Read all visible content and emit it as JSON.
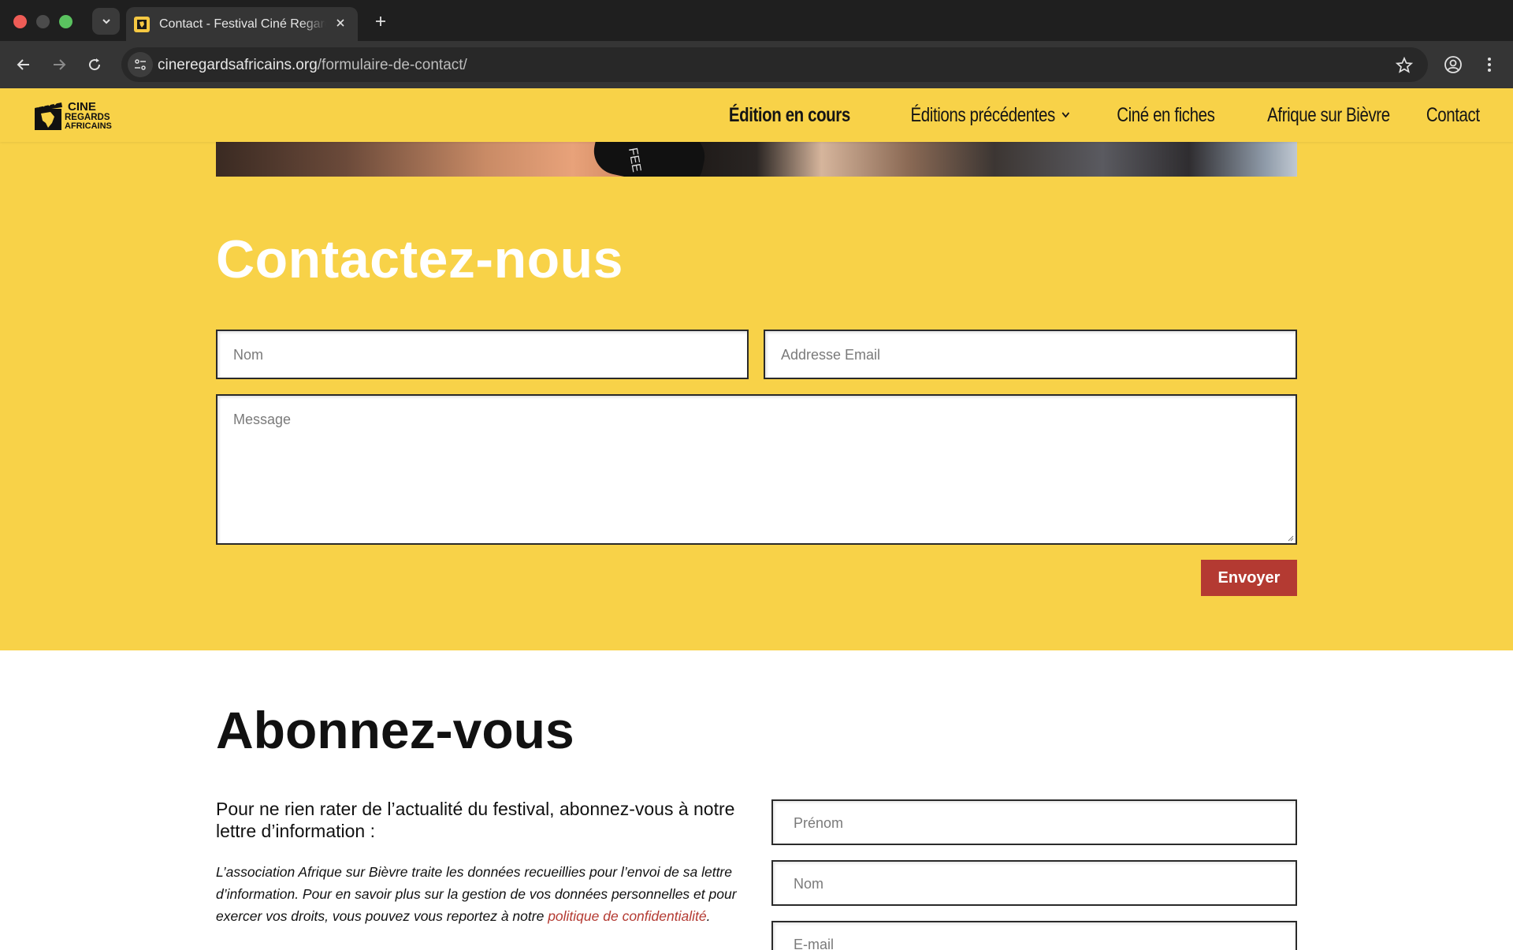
{
  "browser": {
    "tab_title": "Contact - Festival Ciné Regards Africains",
    "url_domain": "cineregardsafricains.org",
    "url_path": "/formulaire-de-contact/"
  },
  "site": {
    "logo_lines": [
      "CINE",
      "REGARDS",
      "AFRICAINS"
    ],
    "menu": [
      {
        "label": "Édition en cours",
        "active": true
      },
      {
        "label": "Éditions précédentes",
        "dropdown": true
      },
      {
        "label": "Ciné en fiches"
      },
      {
        "label": "Afrique sur Bièvre"
      },
      {
        "label": "Contact"
      }
    ],
    "hero_image_text": "FEE",
    "accent_color": "#f8d248",
    "button_color": "#b43a32"
  },
  "contact": {
    "title": "Contactez-nous",
    "name_placeholder": "Nom",
    "email_placeholder": "Addresse Email",
    "message_placeholder": "Message",
    "submit_label": "Envoyer"
  },
  "subscribe": {
    "title": "Abonnez-vous",
    "lead": "Pour ne rien rater de l’actualité du festival, abonnez-vous à notre lettre d’information :",
    "legal_text": "L’association Afrique sur Bièvre traite les données recueillies pour l’envoi de sa lettre d’information. Pour en savoir plus sur la gestion de vos données personnelles et pour exercer vos droits, vous pouvez vous reportez à notre ",
    "legal_link": "politique de confidentialité",
    "legal_end": ".",
    "firstname_placeholder": "Prénom",
    "lastname_placeholder": "Nom",
    "email_placeholder": "E-mail"
  }
}
